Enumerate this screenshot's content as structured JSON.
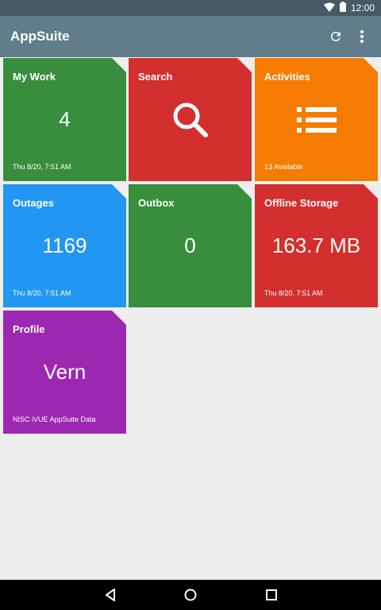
{
  "status_bar": {
    "time": "12:00",
    "icons": [
      "wifi-icon",
      "battery-icon"
    ]
  },
  "app_bar": {
    "title": "AppSuite",
    "actions": [
      "refresh-icon",
      "overflow-menu-icon"
    ]
  },
  "tiles": [
    {
      "title": "My Work",
      "value": "4",
      "subtitle": "Thu 8/20, 7:51 AM",
      "color": "#388e3c"
    },
    {
      "title": "Search",
      "icon": "search-icon",
      "color": "#d32f2f"
    },
    {
      "title": "Activities",
      "icon": "list-icon",
      "subtitle": "13 Available",
      "color": "#f57c00"
    },
    {
      "title": "Outages",
      "value": "1169",
      "subtitle": "Thu 8/20, 7:51 AM",
      "color": "#2196f3"
    },
    {
      "title": "Outbox",
      "value": "0",
      "color": "#388e3c"
    },
    {
      "title": "Offline Storage",
      "value": "163.7 MB",
      "subtitle": "Thu 8/20, 7:51 AM",
      "color": "#d32f2f"
    },
    {
      "title": "Profile",
      "value": "Vern",
      "subtitle": "NISC iVUE AppSuite Data",
      "color": "#9c27b0"
    }
  ],
  "nav_bar": {
    "buttons": [
      "back-icon",
      "home-icon",
      "recents-icon"
    ]
  }
}
